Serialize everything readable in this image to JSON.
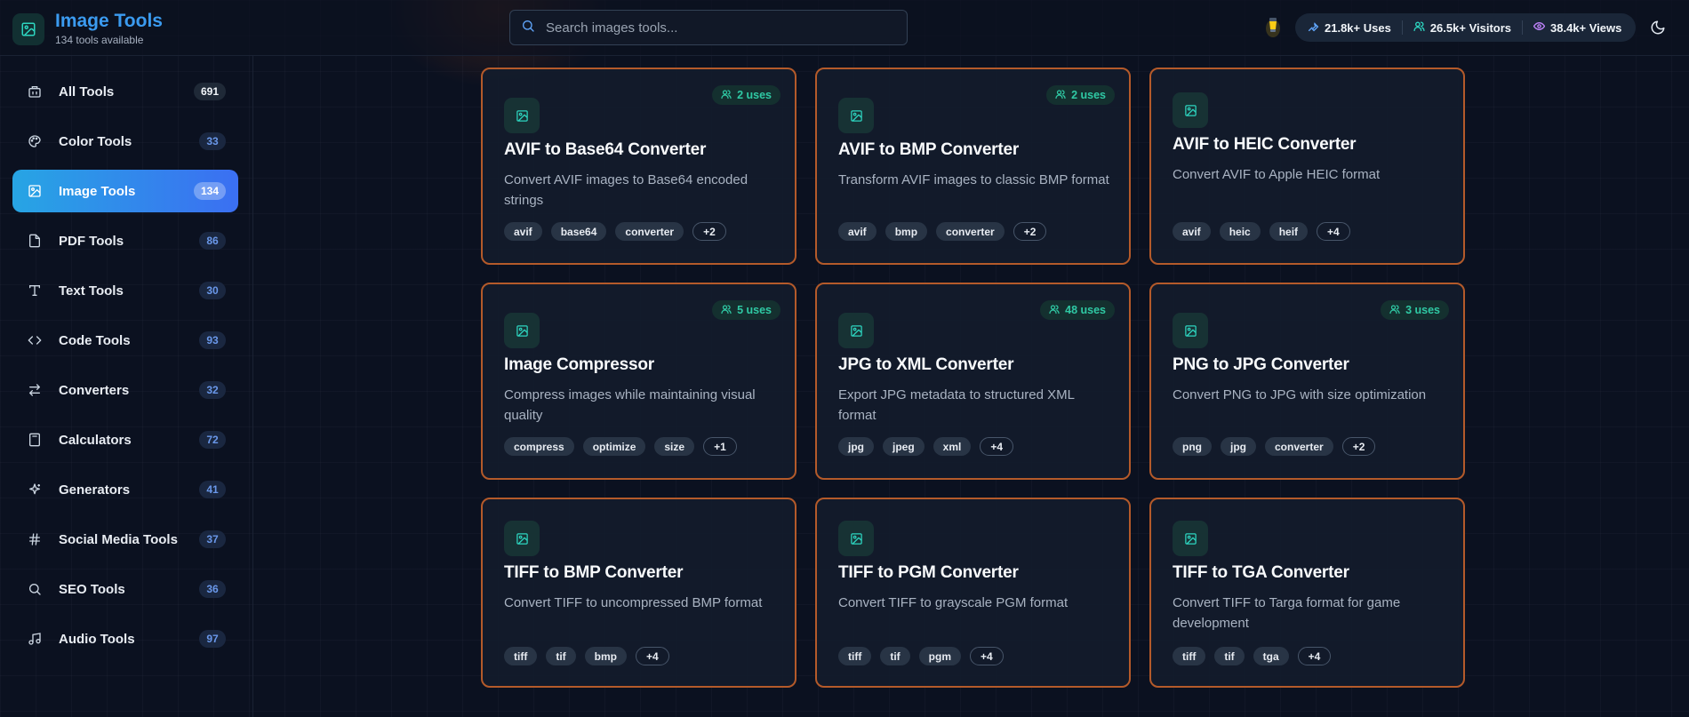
{
  "header": {
    "title": "Image Tools",
    "subtitle": "134 tools available",
    "search_placeholder": "Search images tools...",
    "stats": [
      {
        "label": "21.8k+ Uses",
        "icon": "wrench-icon",
        "color": "#60a5fa"
      },
      {
        "label": "26.5k+ Visitors",
        "icon": "users-icon",
        "color": "#2dd4bf"
      },
      {
        "label": "38.4k+ Views",
        "icon": "eye-icon",
        "color": "#c084fc"
      }
    ]
  },
  "sidebar": {
    "items": [
      {
        "label": "All Tools",
        "count": "691",
        "icon": "all-tools-icon"
      },
      {
        "label": "Color Tools",
        "count": "33",
        "icon": "palette-icon"
      },
      {
        "label": "Image Tools",
        "count": "134",
        "icon": "image-icon",
        "active": true
      },
      {
        "label": "PDF Tools",
        "count": "86",
        "icon": "file-icon"
      },
      {
        "label": "Text Tools",
        "count": "30",
        "icon": "text-icon"
      },
      {
        "label": "Code Tools",
        "count": "93",
        "icon": "code-icon"
      },
      {
        "label": "Converters",
        "count": "32",
        "icon": "swap-icon"
      },
      {
        "label": "Calculators",
        "count": "72",
        "icon": "calculator-icon"
      },
      {
        "label": "Generators",
        "count": "41",
        "icon": "sparkles-icon"
      },
      {
        "label": "Social Media Tools",
        "count": "37",
        "icon": "hash-icon"
      },
      {
        "label": "SEO Tools",
        "count": "36",
        "icon": "search-icon"
      },
      {
        "label": "Audio Tools",
        "count": "97",
        "icon": "music-icon"
      }
    ]
  },
  "cards": [
    {
      "title": "AVIF to Base64 Converter",
      "uses": "2 uses",
      "desc": "Convert AVIF images to Base64 encoded strings",
      "tags": [
        "avif",
        "base64",
        "converter",
        "+2"
      ]
    },
    {
      "title": "AVIF to BMP Converter",
      "uses": "2 uses",
      "desc": "Transform AVIF images to classic BMP format",
      "tags": [
        "avif",
        "bmp",
        "converter",
        "+2"
      ]
    },
    {
      "title": "AVIF to HEIC Converter",
      "uses": "",
      "desc": "Convert AVIF to Apple HEIC format",
      "tags": [
        "avif",
        "heic",
        "heif",
        "+4"
      ]
    },
    {
      "title": "Image Compressor",
      "uses": "5 uses",
      "desc": "Compress images while maintaining visual quality",
      "tags": [
        "compress",
        "optimize",
        "size",
        "+1"
      ]
    },
    {
      "title": "JPG to XML Converter",
      "uses": "48 uses",
      "desc": "Export JPG metadata to structured XML format",
      "tags": [
        "jpg",
        "jpeg",
        "xml",
        "+4"
      ]
    },
    {
      "title": "PNG to JPG Converter",
      "uses": "3 uses",
      "desc": "Convert PNG to JPG with size optimization",
      "tags": [
        "png",
        "jpg",
        "converter",
        "+2"
      ]
    },
    {
      "title": "TIFF to BMP Converter",
      "uses": "",
      "desc": "Convert TIFF to uncompressed BMP format",
      "tags": [
        "tiff",
        "tif",
        "bmp",
        "+4"
      ]
    },
    {
      "title": "TIFF to PGM Converter",
      "uses": "",
      "desc": "Convert TIFF to grayscale PGM format",
      "tags": [
        "tiff",
        "tif",
        "pgm",
        "+4"
      ]
    },
    {
      "title": "TIFF to TGA Converter",
      "uses": "",
      "desc": "Convert TIFF to Targa format for game development",
      "tags": [
        "tiff",
        "tif",
        "tga",
        "+4"
      ]
    }
  ],
  "colors": {
    "accent": "#3b82f6",
    "brand_title": "#3b9bf0",
    "card_border": "#b45a2a",
    "uses_badge": "#2fc9a4"
  }
}
